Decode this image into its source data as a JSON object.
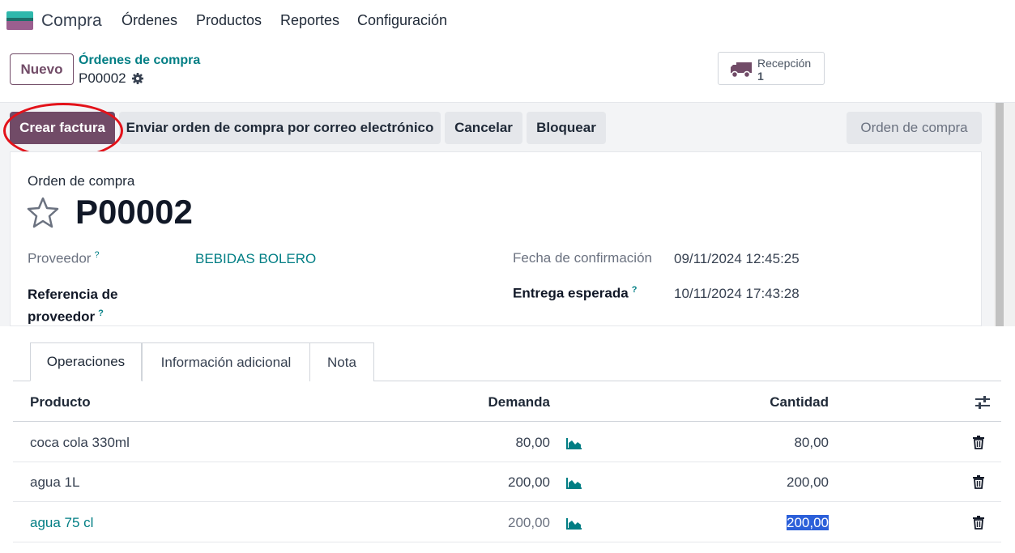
{
  "app": {
    "name": "Compra",
    "menu": [
      "Órdenes",
      "Productos",
      "Reportes",
      "Configuración"
    ]
  },
  "control": {
    "new_label": "Nuevo",
    "breadcrumb": "Órdenes de compra",
    "record": "P00002",
    "smart_button": {
      "label": "Recepción",
      "value": "1"
    }
  },
  "statusbar": {
    "buttons": [
      "Crear factura",
      "Enviar orden de compra por correo electrónico",
      "Cancelar",
      "Bloquear"
    ],
    "state": "Orden de compra"
  },
  "sheet": {
    "subtitle": "Orden de compra",
    "title": "P00002",
    "fields_left": [
      {
        "label": "Proveedor",
        "help": "?",
        "value": "BEBIDAS BOLERO"
      },
      {
        "label_line1": "Referencia de",
        "label_line2": "proveedor",
        "help": "?"
      }
    ],
    "fields_right": [
      {
        "label": "Fecha de confirmación",
        "value": "09/11/2024 12:45:25"
      },
      {
        "label": "Entrega esperada",
        "help": "?",
        "value": "10/11/2024 17:43:28"
      }
    ]
  },
  "notebook": {
    "tabs": [
      "Operaciones",
      "Información adicional",
      "Nota"
    ],
    "columns": [
      "Producto",
      "Demanda",
      "Cantidad"
    ],
    "rows": [
      {
        "product": "coca cola 330ml",
        "demand": "80,00",
        "quantity": "80,00"
      },
      {
        "product": "agua 1L",
        "demand": "200,00",
        "quantity": "200,00"
      },
      {
        "product": "agua 75 cl",
        "demand": "200,00",
        "quantity": "200,00"
      }
    ]
  },
  "colors": {
    "brand": "#714b67",
    "link": "#017e84",
    "annotation": "#e3121a",
    "selection": "#2b5fd9"
  },
  "icons": [
    "purchase-app-icon",
    "gear-icon",
    "truck-icon",
    "star-icon",
    "optional-columns-icon",
    "forecast-chart-icon",
    "trash-icon"
  ]
}
